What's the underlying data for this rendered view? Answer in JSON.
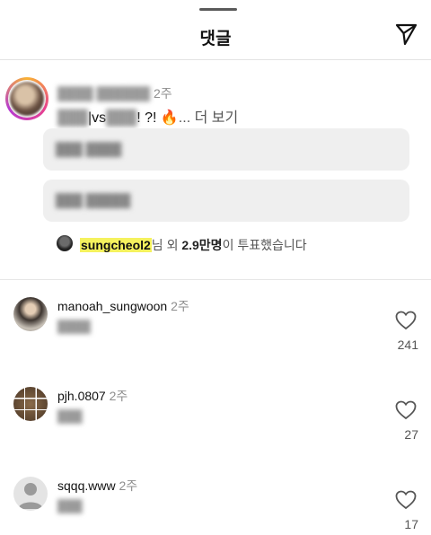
{
  "sheet": {
    "title": "댓글"
  },
  "poll": {
    "username": "—",
    "time": "2주",
    "question_blur": "—",
    "question_mid": "|vs",
    "question_blur2": "—",
    "question_tail": "! ?! 🔥",
    "more": "... 더 보기",
    "options": [
      "—",
      "—"
    ],
    "voters": {
      "user": "sungcheol2",
      "suffix_start": "님 외 ",
      "count": "2.9만명",
      "suffix_end": "이 투표했습니다"
    }
  },
  "comments": [
    {
      "username": "manoah_sungwoon",
      "time": "2주",
      "text": "—",
      "likes": "241"
    },
    {
      "username": "pjh.0807",
      "time": "2주",
      "text": "—",
      "likes": "27"
    },
    {
      "username": "sqqq.www",
      "time": "2주",
      "text": "—",
      "likes": "17"
    }
  ],
  "icons": {
    "send": "send-icon",
    "heart": "heart-icon",
    "fire": "fire-emoji"
  }
}
